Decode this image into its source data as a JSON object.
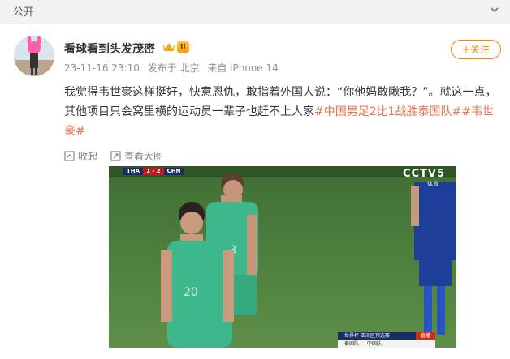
{
  "topbar": {
    "visibility": "公开",
    "chevron_icon": "chevron-down-icon"
  },
  "post": {
    "username": "看球看到头发茂密",
    "vip_badge": "II",
    "time": "23-11-16 23:10",
    "location": "发布于 北京",
    "device": "来自 iPhone 14",
    "follow_label": "+关注",
    "text_prefix": "我觉得韦世豪这样挺好，快意恩仇，敢指着外国人说：“你他妈敢瞅我？”。就这一点，其他项目只会窝里横的运动员一辈子也赶不上人家",
    "hashtag1": "#中国男足2比1战胜泰国队#",
    "hashtag2": "#韦世豪#"
  },
  "actions": {
    "collapse": "收起",
    "view_large": "查看大图"
  },
  "video": {
    "score_team1": "THA",
    "score": "1 - 2",
    "score_team2": "CHN",
    "broadcaster": "CCTV5",
    "broadcaster_sub": "体育",
    "banner_top": "世界杯  亚洲区预选赛",
    "banner_live": "直播",
    "banner_bottom": "泰国队  —  中国队"
  },
  "colors": {
    "accent": "#ff8200",
    "tag": "#eb7350",
    "pitch": "#4e7f3f",
    "jersey": "#3cb88c"
  }
}
